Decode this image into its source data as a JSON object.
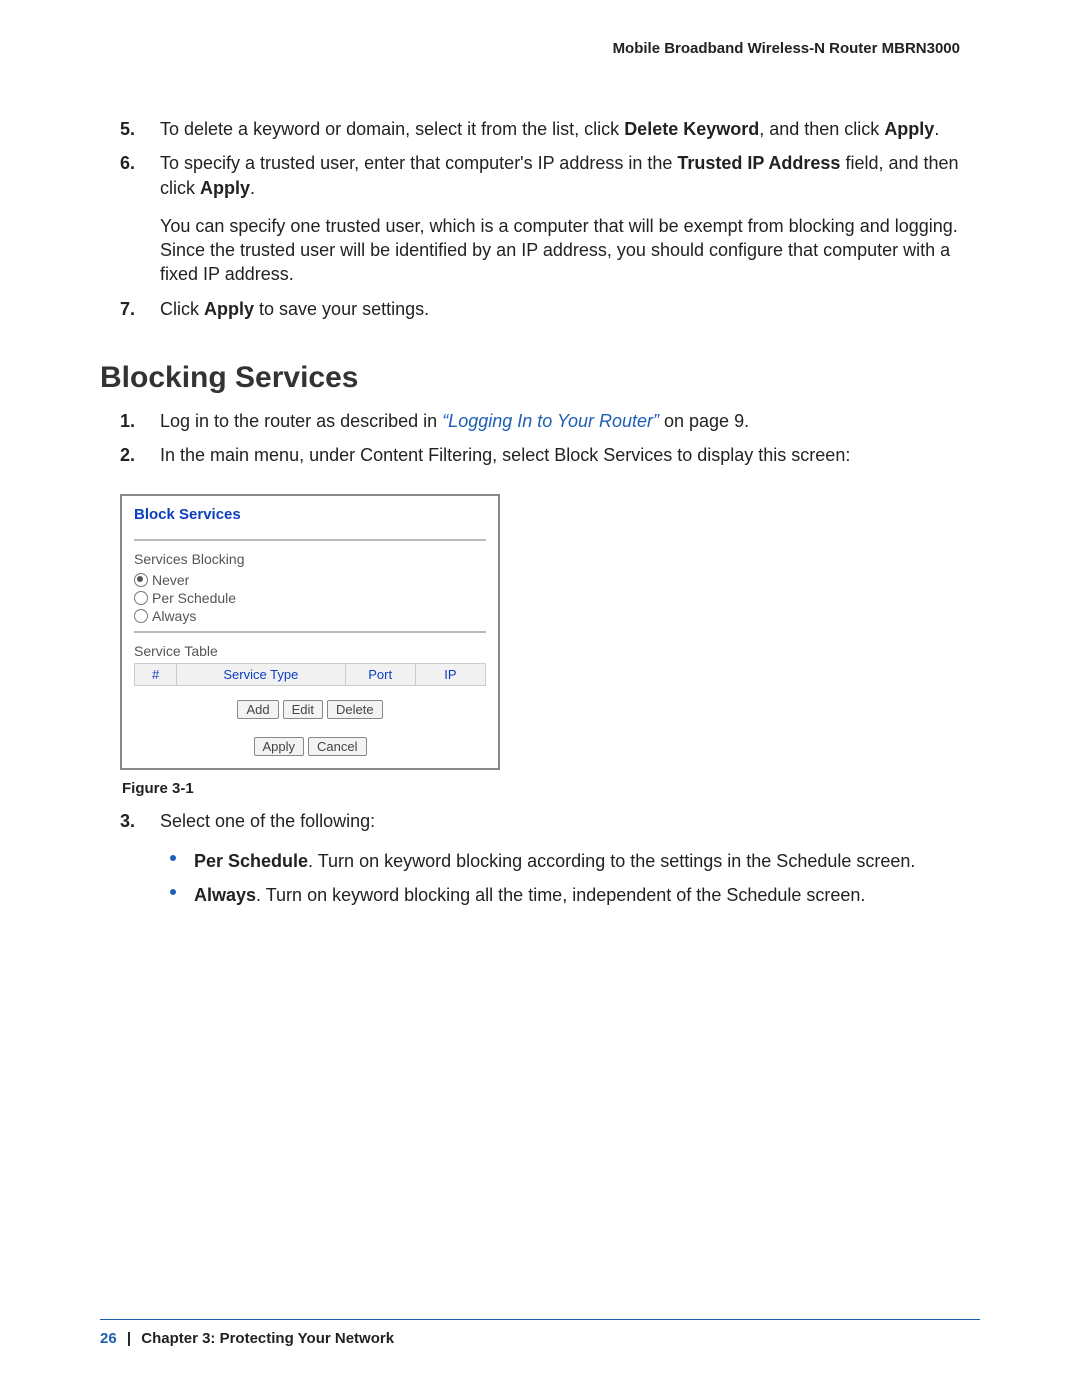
{
  "header": {
    "running_title": "Mobile Broadband Wireless-N Router MBRN3000"
  },
  "top_steps": [
    {
      "num": "5.",
      "frags": [
        {
          "t": "To delete a keyword or domain, select it from the list, click "
        },
        {
          "t": "Delete Keyword",
          "b": true
        },
        {
          "t": ", and then click "
        },
        {
          "t": "Apply",
          "b": true
        },
        {
          "t": "."
        }
      ]
    },
    {
      "num": "6.",
      "frags": [
        {
          "t": "To specify a trusted user, enter that computer's IP address in the "
        },
        {
          "t": "Trusted IP Address",
          "b": true
        },
        {
          "t": " field, and then click "
        },
        {
          "t": "Apply",
          "b": true
        },
        {
          "t": "."
        }
      ],
      "para2": "You can specify one trusted user, which is a computer that will be exempt from blocking and logging. Since the trusted user will be identified by an IP address, you should configure that computer with a fixed IP address."
    },
    {
      "num": "7.",
      "frags": [
        {
          "t": "Click "
        },
        {
          "t": "Apply",
          "b": true
        },
        {
          "t": " to save your settings."
        }
      ]
    }
  ],
  "section_title": "Blocking Services",
  "bs_steps": [
    {
      "num": "1.",
      "frags": [
        {
          "t": "Log in to the router as described in "
        },
        {
          "t": "“Logging In to Your Router”",
          "link": true
        },
        {
          "t": " on page 9."
        }
      ]
    },
    {
      "num": "2.",
      "frags": [
        {
          "t": "In the main menu, under Content Filtering, select Block Services to display this screen:"
        }
      ]
    }
  ],
  "screenshot": {
    "title": "Block Services",
    "group_label": "Services Blocking",
    "radios": [
      {
        "label": "Never",
        "checked": true
      },
      {
        "label": "Per Schedule",
        "checked": false
      },
      {
        "label": "Always",
        "checked": false
      }
    ],
    "table_label": "Service Table",
    "cols": [
      "#",
      "Service Type",
      "Port",
      "IP"
    ],
    "row_buttons": [
      "Add",
      "Edit",
      "Delete"
    ],
    "form_buttons": [
      "Apply",
      "Cancel"
    ]
  },
  "figure_caption": "Figure 3-1",
  "bs_step3": {
    "num": "3.",
    "lead": "Select one of the following:",
    "bullets": [
      {
        "bold": "Per Schedule",
        "rest": ". Turn on keyword blocking according to the settings in the Schedule screen."
      },
      {
        "bold": "Always",
        "rest": ". Turn on keyword blocking all the time, independent of the Schedule screen."
      }
    ]
  },
  "footer": {
    "page": "26",
    "chapter": "Chapter 3:  Protecting Your Network"
  }
}
